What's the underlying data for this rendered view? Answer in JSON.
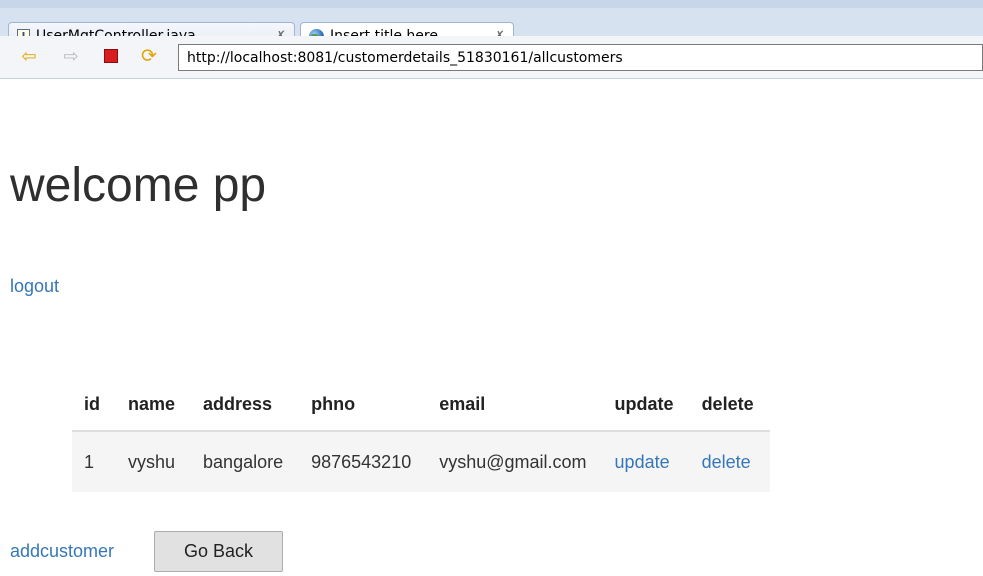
{
  "tabs": [
    {
      "label": "UserMgtController.java",
      "icon": "java-file-icon"
    },
    {
      "label": "Insert title here",
      "icon": "globe-icon"
    }
  ],
  "close_glyph": "✗",
  "nav": {
    "url": "http://localhost:8081/customerdetails_51830161/allcustomers"
  },
  "page": {
    "title": "welcome pp",
    "logout_label": "logout",
    "addcustomer_label": "addcustomer",
    "go_back_label": "Go Back"
  },
  "table": {
    "headers": [
      "id",
      "name",
      "address",
      "phno",
      "email",
      "update",
      "delete"
    ],
    "rows": [
      {
        "id": "1",
        "name": "vyshu",
        "address": "bangalore",
        "phno": "9876543210",
        "email": "vyshu@gmail.com",
        "update": "update",
        "delete": "delete"
      }
    ]
  },
  "colors": {
    "link": "#3577b8",
    "tabbar": "#d6e2f0",
    "row_background": "#f5f5f5"
  }
}
